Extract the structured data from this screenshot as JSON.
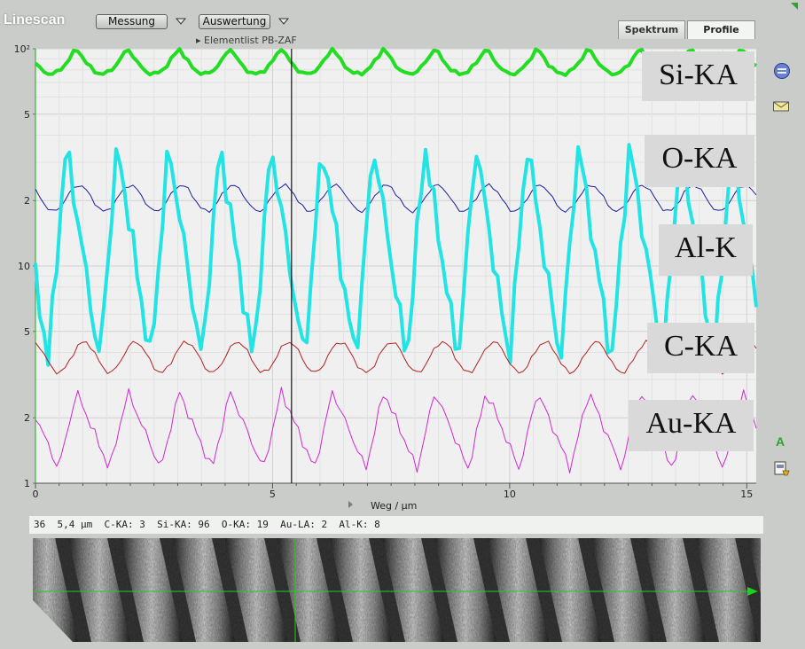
{
  "toolbar": {
    "app_title": "Linescan",
    "measure_label": "Messung",
    "evaluate_label": "Auswertung",
    "breadcrumb": "Elementlist PB-ZAF"
  },
  "tabs": [
    {
      "label": "Spektrum",
      "active": false
    },
    {
      "label": "Profile",
      "active": true
    }
  ],
  "status": {
    "readout": "36  5,4 µm  C-KA: 3  Si-KA: 96  O-KA: 19  Au-LA: 2  Al-K: 8"
  },
  "side_icons": [
    "navigate-icon",
    "envelope-icon",
    "text-a-icon",
    "export-icon"
  ],
  "side_letter": "A",
  "chart_data": {
    "type": "line",
    "xlabel": "Weg / µm",
    "ylabel": "",
    "xlim": [
      0,
      15.2
    ],
    "ylim": [
      1,
      100
    ],
    "yscale": "log",
    "x_ticks": [
      "0",
      "5",
      "10",
      "15"
    ],
    "y_ticks": [
      {
        "value": 1,
        "label": "1"
      },
      {
        "value": 2,
        "label": "2"
      },
      {
        "value": 5,
        "label": "5"
      },
      {
        "value": 10,
        "label": "10"
      },
      {
        "value": 20,
        "label": "2"
      },
      {
        "value": 50,
        "label": "5"
      },
      {
        "value": 100,
        "label": "10²"
      }
    ],
    "grid": true,
    "cursor_x": 5.4,
    "series": [
      {
        "name": "Si-KA",
        "color": "#22dd22",
        "width": 4,
        "mean": 88,
        "amp": 0.06,
        "period": 1.08,
        "phase": 0.2,
        "shape": "cusp"
      },
      {
        "name": "O-KA",
        "color": "#1d1d9e",
        "width": 1,
        "mean": 20.5,
        "amp": 0.06,
        "period": 1.08,
        "phase": 0.4,
        "shape": "sine"
      },
      {
        "name": "Al-K",
        "color": "#22e4e4",
        "width": 4,
        "mean": 11.5,
        "amp": 0.5,
        "period": 1.08,
        "phase": 0.75,
        "shape": "saw"
      },
      {
        "name": "C-KA",
        "color": "#b52020",
        "width": 1,
        "mean": 3.8,
        "amp": 0.07,
        "period": 1.08,
        "phase": 0.3,
        "shape": "sine"
      },
      {
        "name": "Au-KA",
        "color": "#d228d2",
        "width": 1,
        "mean": 1.75,
        "amp": 0.18,
        "period": 1.08,
        "phase": 0.55,
        "shape": "saw"
      }
    ],
    "labels": [
      "Si-KA",
      "O-KA",
      "Al-K",
      "C-KA",
      "Au-KA"
    ]
  }
}
